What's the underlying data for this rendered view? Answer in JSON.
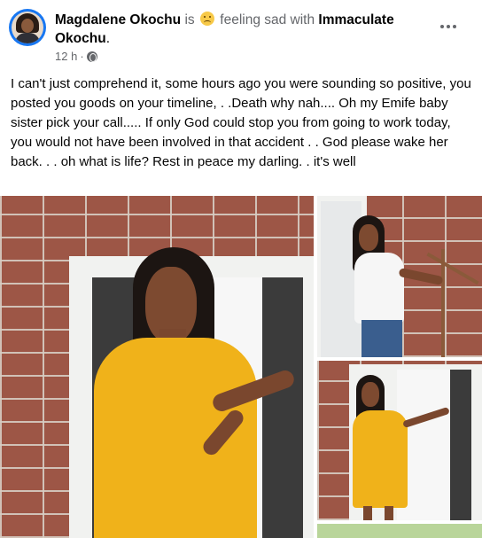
{
  "post": {
    "author": "Magdalene Okochu",
    "verb_is": "is",
    "feeling": "feeling sad with",
    "tagged_name": "Immaculate Okochu",
    "punct": ".",
    "time": "12 h",
    "dot": "·",
    "text": "I can't just comprehend it, some hours ago you were sounding so positive, you posted you goods on your timeline, . .Death why nah.... Oh my Emife baby sister pick your call..... If only God could stop you from going to work today, you would not have been involved in that accident . . God please wake her back. . . oh what is life? Rest in peace my darling. . it's well"
  },
  "icons": {
    "avatar": "profile-avatar",
    "feeling": "sad-face-icon",
    "audience": "globe-icon",
    "more": "more-options-icon"
  },
  "colors": {
    "secondary_text": "#65676b",
    "dress": "#f0b21a",
    "brick": "#9d5646"
  }
}
